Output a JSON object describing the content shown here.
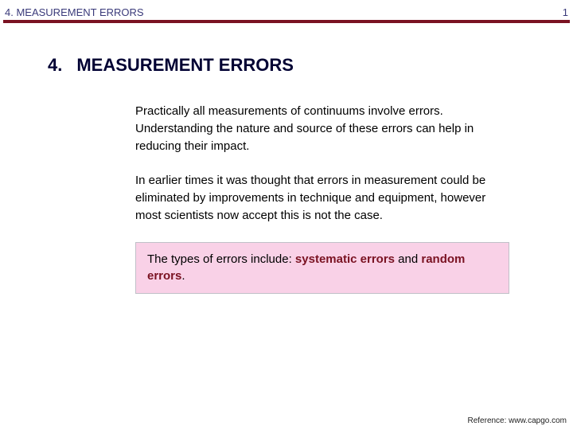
{
  "header": {
    "left": "4. MEASUREMENT ERRORS",
    "page_number": "1"
  },
  "section": {
    "number": "4.",
    "title": "MEASUREMENT ERRORS"
  },
  "paragraphs": {
    "p1": "Practically all measurements of continuums involve errors. Understanding the nature and source of these errors can help in reducing their impact.",
    "p2": "In earlier times it was thought that errors in measurement could be eliminated by improvements in technique and equipment, however most scientists now accept this is not the case."
  },
  "highlight": {
    "lead": "The types of errors include: ",
    "term1": "systematic errors",
    "joiner": " and ",
    "term2": "random errors",
    "tail": "."
  },
  "footer": {
    "reference": "Reference: www.capgo.com"
  },
  "colors": {
    "rule": "#7a1222",
    "heading": "#000033",
    "highlight_bg": "#f9d1e7",
    "highlight_term": "#7a1222"
  }
}
